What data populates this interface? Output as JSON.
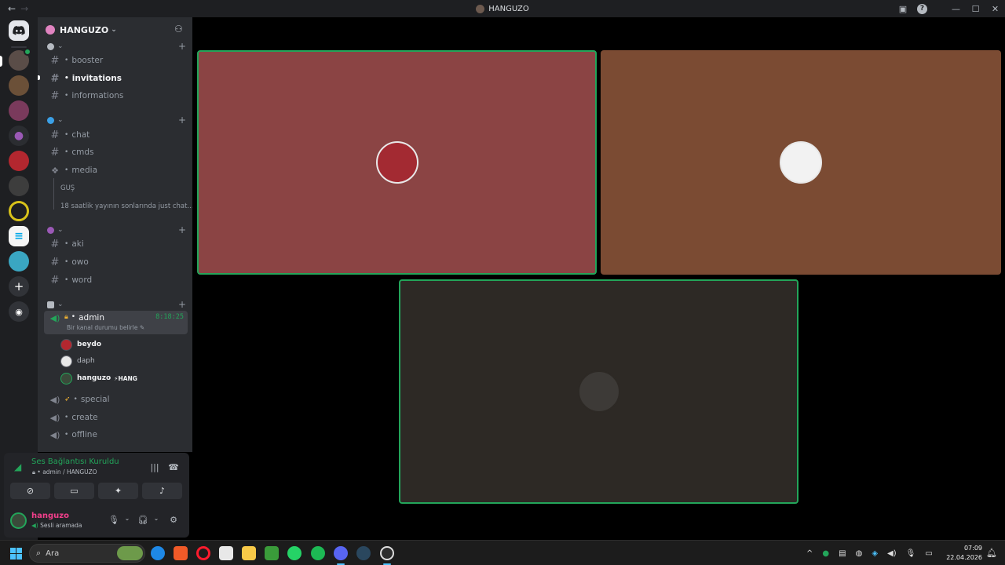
{
  "window": {
    "title": "HANGUZO",
    "back_glyph": "←",
    "forward_glyph": "→"
  },
  "guild": {
    "name": "HANGUZO"
  },
  "categories": [
    {
      "icon": "gear-icon",
      "channels": [
        {
          "name": "booster",
          "type": "text"
        },
        {
          "name": "invitations",
          "type": "text",
          "active": true
        },
        {
          "name": "informations",
          "type": "text"
        }
      ]
    },
    {
      "icon": "globe-icon",
      "channels": [
        {
          "name": "chat",
          "type": "text"
        },
        {
          "name": "cmds",
          "type": "text"
        },
        {
          "name": "media",
          "type": "forum"
        }
      ],
      "threads": [
        "GUŞ",
        "18 saatlik yayının sonlarında just chat..."
      ]
    },
    {
      "icon": "eggplant-icon",
      "channels": [
        {
          "name": "aki",
          "type": "text"
        },
        {
          "name": "owo",
          "type": "text"
        },
        {
          "name": "word",
          "type": "text"
        }
      ]
    },
    {
      "icon": "microphone-icon",
      "voice_channels": [
        {
          "name": "admin",
          "timer": "8:18:25",
          "status": "Bir kanal durumu belirle",
          "members": [
            {
              "name": "beydo"
            },
            {
              "name": "daph"
            },
            {
              "name": "hanguzo",
              "tag": "HANG"
            }
          ]
        },
        {
          "name": "special"
        },
        {
          "name": "create"
        },
        {
          "name": "offline"
        }
      ]
    }
  ],
  "voice_connection": {
    "status": "Ses Bağlantısı Kuruldu",
    "location": "admin / HANGUZO"
  },
  "user": {
    "name": "hanguzo",
    "status": "Sesli aramada"
  },
  "taskbar": {
    "search_placeholder": "Ara",
    "time": "07:09",
    "date": "22.04.2026"
  },
  "colors": {
    "accent_green": "#23a55a",
    "tile_1": "#8b4444",
    "tile_2": "#7b4b33",
    "tile_3": "#2d2925"
  }
}
